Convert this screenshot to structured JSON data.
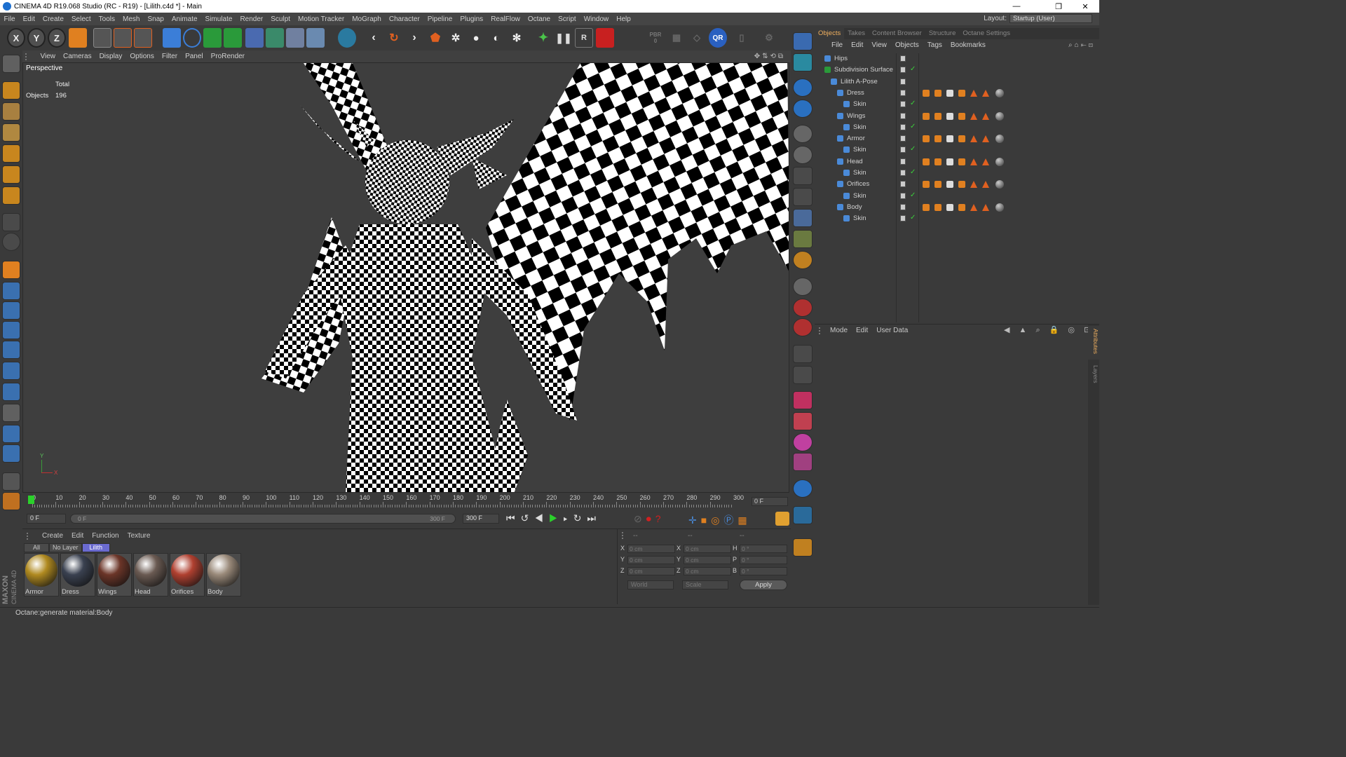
{
  "window": {
    "title": "CINEMA 4D R19.068 Studio (RC - R19) - [Lilith.c4d *] - Main",
    "controls": [
      "—",
      "❐",
      "✕"
    ]
  },
  "menubar": {
    "items": [
      "File",
      "Edit",
      "Create",
      "Select",
      "Tools",
      "Mesh",
      "Snap",
      "Animate",
      "Simulate",
      "Render",
      "Sculpt",
      "Motion Tracker",
      "MoGraph",
      "Character",
      "Pipeline",
      "Plugins",
      "RealFlow",
      "Octane",
      "Script",
      "Window",
      "Help"
    ],
    "layout_label": "Layout:",
    "layout_value": "Startup (User)"
  },
  "toolbar": {
    "axis_x": "X",
    "axis_y": "Y",
    "axis_z": "Z",
    "pbr": "PBR",
    "pbr_val": "0",
    "qr": "QR",
    "render_r": "R"
  },
  "viewport": {
    "menu": [
      "View",
      "Cameras",
      "Display",
      "Options",
      "Filter",
      "Panel",
      "ProRender"
    ],
    "name": "Perspective",
    "stats_header": "Total",
    "stats_label": "Objects",
    "stats_value": "196",
    "axis_y": "Y",
    "axis_x": "X"
  },
  "timeline": {
    "ticks": [
      "0",
      "10",
      "20",
      "30",
      "40",
      "50",
      "60",
      "70",
      "80",
      "90",
      "100",
      "110",
      "120",
      "130",
      "140",
      "150",
      "160",
      "170",
      "180",
      "190",
      "200",
      "210",
      "220",
      "230",
      "240",
      "250",
      "260",
      "270",
      "280",
      "290",
      "300"
    ],
    "current_frame_display": "0 F",
    "start_frame": "0 F",
    "range_start": "0 F",
    "range_end": "300 F",
    "end_frame": "300 F"
  },
  "materials": {
    "menu": [
      "Create",
      "Edit",
      "Function",
      "Texture"
    ],
    "layer_tabs": [
      "All",
      "No Layer",
      "Lilith"
    ],
    "active_layer": "Lilith",
    "items": [
      {
        "name": "Armor",
        "color": "#b08a20"
      },
      {
        "name": "Dress",
        "color": "#3a4150"
      },
      {
        "name": "Wings",
        "color": "#6b3528"
      },
      {
        "name": "Head",
        "color": "#6a5a52"
      },
      {
        "name": "Orifices",
        "color": "#b04030"
      },
      {
        "name": "Body",
        "color": "#9a8a7a"
      }
    ]
  },
  "coords": {
    "header_cols": [
      "--",
      "--",
      "--"
    ],
    "rows": [
      {
        "l1": "X",
        "v1": "0 cm",
        "l2": "X",
        "v2": "0 cm",
        "l3": "H",
        "v3": "0 °"
      },
      {
        "l1": "Y",
        "v1": "0 cm",
        "l2": "Y",
        "v2": "0 cm",
        "l3": "P",
        "v3": "0 °"
      },
      {
        "l1": "Z",
        "v1": "0 cm",
        "l2": "Z",
        "v2": "0 cm",
        "l3": "B",
        "v3": "0 °"
      }
    ],
    "space": "World",
    "mode": "Scale",
    "apply_label": "Apply"
  },
  "objects_panel": {
    "tabs": [
      "Objects",
      "Takes",
      "Content Browser",
      "Structure",
      "Octane Settings"
    ],
    "active_tab": "Objects",
    "menu": [
      "File",
      "Edit",
      "View",
      "Objects",
      "Tags",
      "Bookmarks"
    ],
    "tree": [
      {
        "name": "Hips",
        "depth": 0
      },
      {
        "name": "Subdivision Surface",
        "depth": 0
      },
      {
        "name": "Lilith A-Pose",
        "depth": 1
      },
      {
        "name": "Dress",
        "depth": 2
      },
      {
        "name": "Skin",
        "depth": 3
      },
      {
        "name": "Wings",
        "depth": 2
      },
      {
        "name": "Skin",
        "depth": 3
      },
      {
        "name": "Armor",
        "depth": 2
      },
      {
        "name": "Skin",
        "depth": 3
      },
      {
        "name": "Head",
        "depth": 2
      },
      {
        "name": "Skin",
        "depth": 3
      },
      {
        "name": "Orifices",
        "depth": 2
      },
      {
        "name": "Skin",
        "depth": 3
      },
      {
        "name": "Body",
        "depth": 2
      },
      {
        "name": "Skin",
        "depth": 3
      }
    ]
  },
  "attributes_panel": {
    "menu": [
      "Mode",
      "Edit",
      "User Data"
    ],
    "side_tabs": [
      "Attributes",
      "Layers"
    ]
  },
  "brand": {
    "line1": "MAXON",
    "line2": "CINEMA 4D"
  },
  "statusbar": {
    "text": "Octane:generate material:Body"
  },
  "colors": {
    "accent": "#f0b060",
    "keyframe_green": "#2bd12b",
    "selection_blue": "#3f6ec8"
  }
}
